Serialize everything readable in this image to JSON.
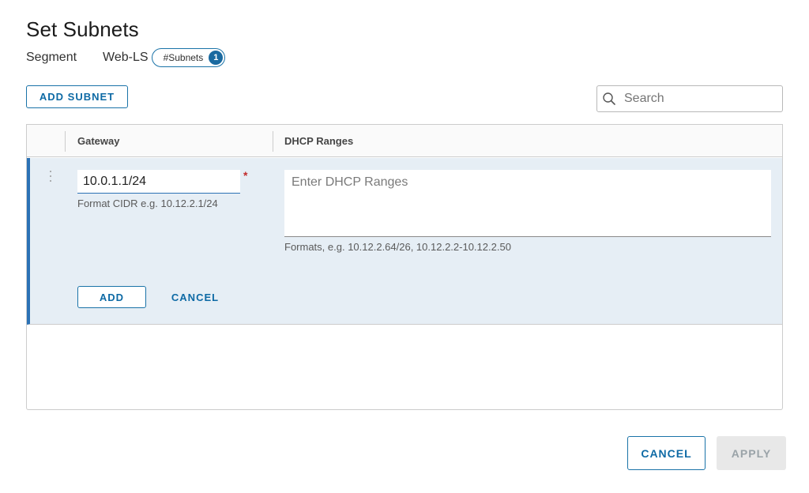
{
  "dialog": {
    "title": "Set Subnets",
    "segment_label": "Segment",
    "segment_name": "Web-LS",
    "subnets_pill_label": "#Subnets",
    "subnets_count": "1"
  },
  "toolbar": {
    "add_subnet_label": "ADD SUBNET",
    "search_placeholder": "Search",
    "search_icon": "search-icon"
  },
  "grid": {
    "columns": [
      "Gateway",
      "DHCP Ranges"
    ],
    "edit_row": {
      "gateway_value": "10.0.1.1/24",
      "gateway_required_mark": "*",
      "gateway_hint": "Format CIDR e.g. 10.12.2.1/24",
      "dhcp_placeholder": "Enter DHCP Ranges",
      "dhcp_hint": "Formats, e.g. 10.12.2.64/26, 10.12.2.2-10.12.2.50",
      "add_label": "ADD",
      "cancel_label": "CANCEL"
    }
  },
  "footer": {
    "cancel_label": "CANCEL",
    "apply_label": "APPLY"
  },
  "colors": {
    "accent": "#0e6aa5",
    "edit_row_bg": "#e6eef5",
    "required": "#c12b2b",
    "disabled_bg": "#e8e8e8"
  }
}
